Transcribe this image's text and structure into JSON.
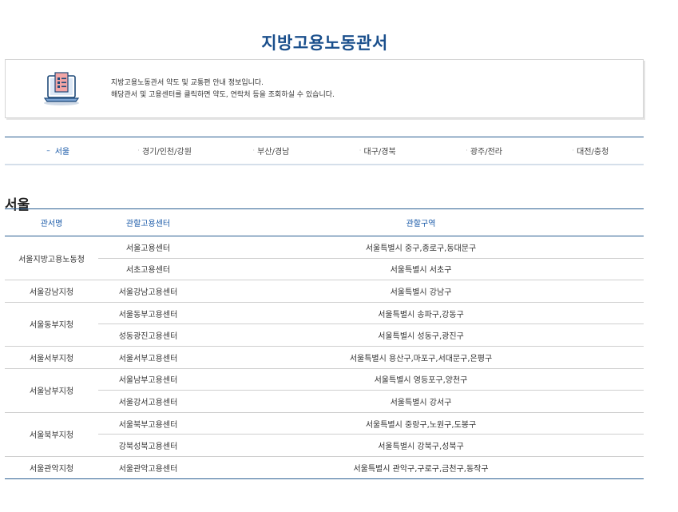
{
  "page": {
    "title": "지방고용노동관서"
  },
  "intro": {
    "line1": "지방고용노동관서 약도 및 교통편 안내 정보입니다.",
    "line2": "해당관서 및 고용센터를 클릭하면 약도, 연락처 등을 조회하실 수 있습니다."
  },
  "tabs": [
    {
      "label": "서울",
      "active": true
    },
    {
      "label": "경기/인천/강원",
      "active": false
    },
    {
      "label": "부산/경남",
      "active": false
    },
    {
      "label": "대구/경북",
      "active": false
    },
    {
      "label": "광주/전라",
      "active": false
    },
    {
      "label": "대전/충청",
      "active": false
    }
  ],
  "section": {
    "title": "서울"
  },
  "table": {
    "headers": [
      "관서명",
      "관할고용센터",
      "관할구역"
    ],
    "groups": [
      {
        "office": "서울지방고용노동청",
        "rows": [
          {
            "center": "서울고용센터",
            "area": "서울특별시 중구,종로구,동대문구"
          },
          {
            "center": "서초고용센터",
            "area": "서울특별시 서초구"
          }
        ]
      },
      {
        "office": "서울강남지청",
        "rows": [
          {
            "center": "서울강남고용센터",
            "area": "서울특별시 강남구"
          }
        ]
      },
      {
        "office": "서울동부지청",
        "rows": [
          {
            "center": "서울동부고용센터",
            "area": "서울특별시 송파구,강동구"
          },
          {
            "center": "성동광진고용센터",
            "area": "서울특별시 성동구,광진구"
          }
        ]
      },
      {
        "office": "서울서부지청",
        "rows": [
          {
            "center": "서울서부고용센터",
            "area": "서울특별시 용산구,마포구,서대문구,은평구"
          }
        ]
      },
      {
        "office": "서울남부지청",
        "rows": [
          {
            "center": "서울남부고용센터",
            "area": "서울특별시 영등포구,양천구"
          },
          {
            "center": "서울강서고용센터",
            "area": "서울특별시 강서구"
          }
        ]
      },
      {
        "office": "서울북부지청",
        "rows": [
          {
            "center": "서울북부고용센터",
            "area": "서울특별시 중랑구,노원구,도봉구"
          },
          {
            "center": "강북성북고용센터",
            "area": "서울특별시 강북구,성북구"
          }
        ]
      },
      {
        "office": "서울관악지청",
        "rows": [
          {
            "center": "서울관악고용센터",
            "area": "서울특별시 관악구,구로구,금천구,동작구"
          }
        ]
      }
    ]
  },
  "colors": {
    "accent": "#1a5aa8",
    "title": "#1a4f8c",
    "rule": "#2b5f92"
  }
}
